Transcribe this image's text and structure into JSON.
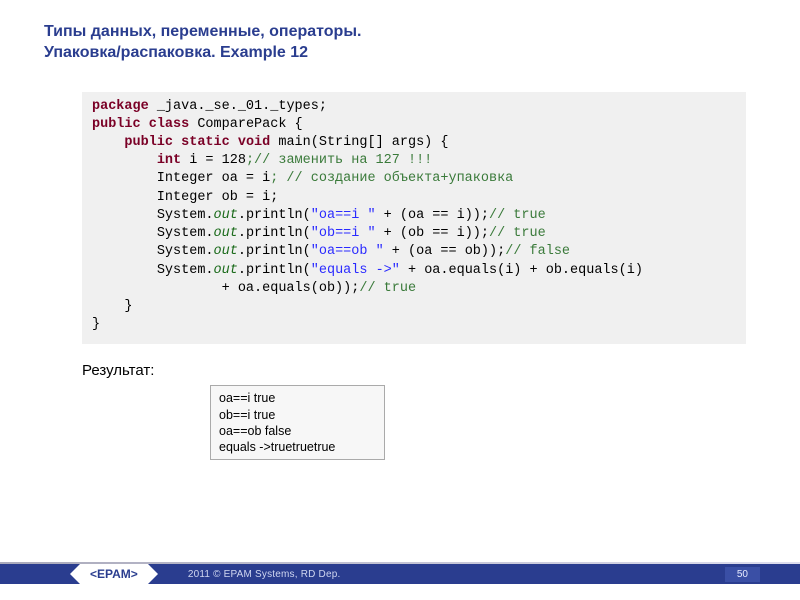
{
  "slide": {
    "title_line1": "Типы данных, переменные, операторы.",
    "title_line2": "Упаковка/распаковка. Example 12"
  },
  "code": {
    "package_kw": "package",
    "package_name": " _java._se._01._types;",
    "public_kw": "public",
    "class_kw": "class",
    "class_name": " ComparePack {",
    "static_kw": "static",
    "void_kw": "void",
    "main_sig": " main(String[] args) {",
    "int_kw": "int",
    "int_decl": " i = 128",
    "cmt1": ";// заменить на 127 !!!",
    "line_oa": "        Integer oa = i",
    "cmt2": "; // создание объекта+упаковка",
    "line_ob": "        Integer ob = i;",
    "sys": "System.",
    "out": "out",
    "p1a": ".println(",
    "s1": "\"oa==i \"",
    "p1b": " + (oa == i));",
    "c1": "// true",
    "s2": "\"ob==i \"",
    "p2b": " + (ob == i));",
    "c2": "// true",
    "s3": "\"oa==ob \"",
    "p3b": " + (oa == ob));",
    "c3": "// false",
    "s4": "\"equals ->\"",
    "p4b": " + oa.equals(i) + ob.equals(i)",
    "p4c": "                + oa.equals(ob));",
    "c4": "// true",
    "close1": "    }",
    "close2": "}"
  },
  "result": {
    "label": "Результат:",
    "lines": "oa==i true\nob==i true\noa==ob false\nequals ->truetruetrue"
  },
  "footer": {
    "logo": "EPAM",
    "copy": "2011 © EPAM Systems, RD Dep.",
    "page": "50"
  }
}
